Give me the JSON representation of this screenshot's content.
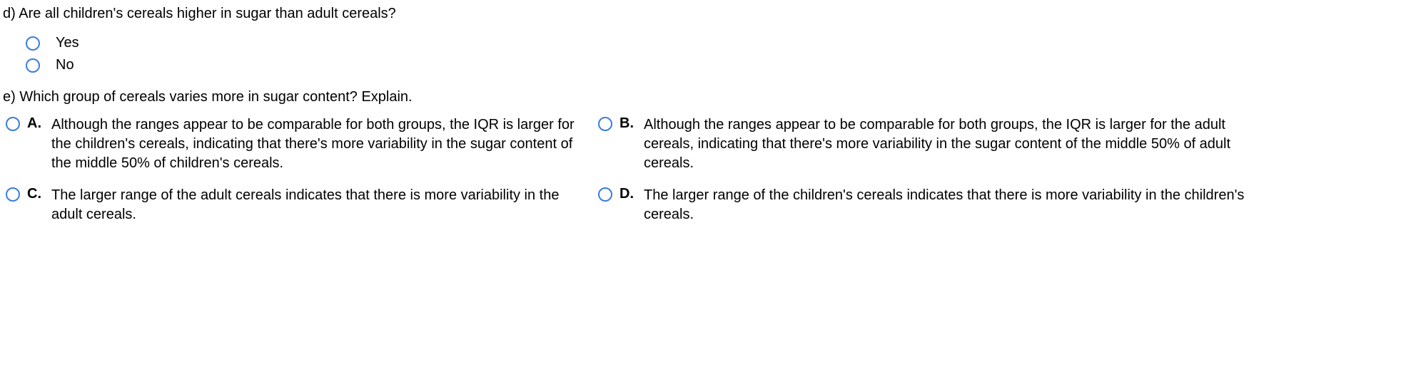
{
  "question_d": {
    "prompt": "d) Are all children's cereels higher in sugar than adult cereals?",
    "prompt_actual": "d) Are all children's cereals higher in sugar than adult cereals?",
    "options": {
      "yes": "Yes",
      "no": "No"
    }
  },
  "question_e": {
    "prompt": "e) Which group of cereals varies more in sugar content? Explain.",
    "choices": {
      "a": {
        "letter": "A.",
        "text": "Although the ranges appear to be comparable for both groups, the IQR is larger for the children's cereals, indicating that there's more variability in the sugar content of the middle 50% of children's cereals."
      },
      "b": {
        "letter": "B.",
        "text": "Although the ranges appear to be comparable for both groups, the IQR is larger for the adult cereals, indicating that there's more variability in the sugar content of the middle 50% of adult cereals."
      },
      "c": {
        "letter": "C.",
        "text": "The larger range of the adult cereals indicates that there is more variability in the adult cereals."
      },
      "d": {
        "letter": "D.",
        "text": "The larger range of the children's cereals indicates that there is more variability in the children's cereals."
      }
    }
  }
}
